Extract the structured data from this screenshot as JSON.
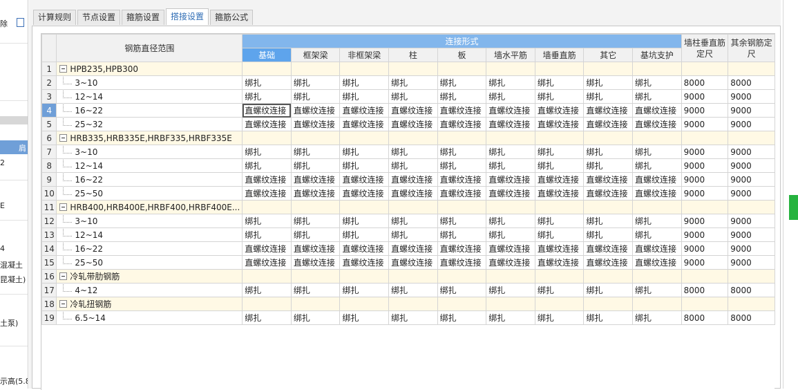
{
  "background": {
    "fragments": [
      "除",
      "2",
      "E",
      "4",
      "混凝土",
      "昆凝土)",
      "土泵)",
      "示高(5.8"
    ],
    "header_fragment": "肩"
  },
  "tabs": [
    "计算规则",
    "节点设置",
    "箍筋设置",
    "搭接设置",
    "箍筋公式"
  ],
  "active_tab": 3,
  "table": {
    "range_header": "钢筋直径范围",
    "group_header": "连接形式",
    "conn_columns": [
      "基础",
      "框架梁",
      "非框架梁",
      "柱",
      "板",
      "墙水平筋",
      "墙垂直筋",
      "其它",
      "基坑支护"
    ],
    "extra_columns": [
      "墙柱垂直筋定尺",
      "其余钢筋定尺"
    ],
    "rows": [
      {
        "no": "1",
        "group": true,
        "label": "HPB235,HPB300"
      },
      {
        "no": "2",
        "label": "3~10",
        "conn": "绑扎",
        "v1": "8000",
        "v2": "8000"
      },
      {
        "no": "3",
        "label": "12~14",
        "conn": "绑扎",
        "v1": "9000",
        "v2": "9000"
      },
      {
        "no": "4",
        "label": "16~22",
        "conn": "直螺纹连接",
        "v1": "9000",
        "v2": "9000",
        "selected": true
      },
      {
        "no": "5",
        "label": "25~32",
        "conn": "直螺纹连接",
        "v1": "9000",
        "v2": "9000"
      },
      {
        "no": "6",
        "group": true,
        "label": "HRB335,HRB335E,HRBF335,HRBF335E"
      },
      {
        "no": "7",
        "label": "3~10",
        "conn": "绑扎",
        "v1": "9000",
        "v2": "9000"
      },
      {
        "no": "8",
        "label": "12~14",
        "conn": "绑扎",
        "v1": "9000",
        "v2": "9000"
      },
      {
        "no": "9",
        "label": "16~22",
        "conn": "直螺纹连接",
        "v1": "9000",
        "v2": "9000"
      },
      {
        "no": "10",
        "label": "25~50",
        "conn": "直螺纹连接",
        "v1": "9000",
        "v2": "9000"
      },
      {
        "no": "11",
        "group": true,
        "label": "HRB400,HRB400E,HRBF400,HRBF400E..."
      },
      {
        "no": "12",
        "label": "3~10",
        "conn": "绑扎",
        "v1": "9000",
        "v2": "9000"
      },
      {
        "no": "13",
        "label": "12~14",
        "conn": "绑扎",
        "v1": "9000",
        "v2": "9000"
      },
      {
        "no": "14",
        "label": "16~22",
        "conn": "直螺纹连接",
        "v1": "9000",
        "v2": "9000"
      },
      {
        "no": "15",
        "label": "25~50",
        "conn": "直螺纹连接",
        "v1": "9000",
        "v2": "9000"
      },
      {
        "no": "16",
        "group": true,
        "label": "冷轧带肋钢筋"
      },
      {
        "no": "17",
        "label": "4~12",
        "conn": "绑扎",
        "v1": "8000",
        "v2": "8000"
      },
      {
        "no": "18",
        "group": true,
        "label": "冷轧扭钢筋"
      },
      {
        "no": "19",
        "label": "6.5~14",
        "conn": "绑扎",
        "v1": "8000",
        "v2": "8000"
      }
    ]
  }
}
